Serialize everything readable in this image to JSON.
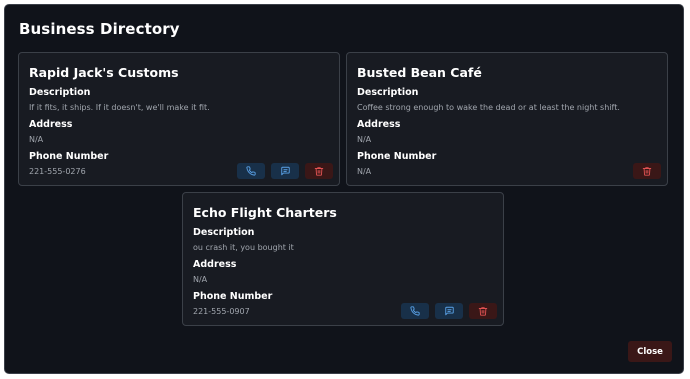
{
  "dialog": {
    "title": "Business Directory",
    "close_label": "Close"
  },
  "labels": {
    "description": "Description",
    "address": "Address",
    "phone": "Phone Number"
  },
  "businesses": [
    {
      "name": "Rapid Jack's Customs",
      "description": "If it fits, it ships. If it doesn't, we'll make it fit.",
      "address": "N/A",
      "phone": "221-555-0276"
    },
    {
      "name": "Busted Bean Café",
      "description": "Coffee strong enough to wake the dead or at least the night shift.",
      "address": "N/A",
      "phone": "N/A"
    },
    {
      "name": "Echo Flight Charters",
      "description": "ou crash it, you bought it",
      "address": "N/A",
      "phone": "221-555-0907"
    }
  ],
  "icons": {
    "call": "phone-icon",
    "message": "message-icon",
    "delete": "trash-icon"
  },
  "colors": {
    "background": "#10131a",
    "card": "#181b22",
    "accent_blue": "#5aa2e8",
    "accent_red": "#e05252"
  }
}
